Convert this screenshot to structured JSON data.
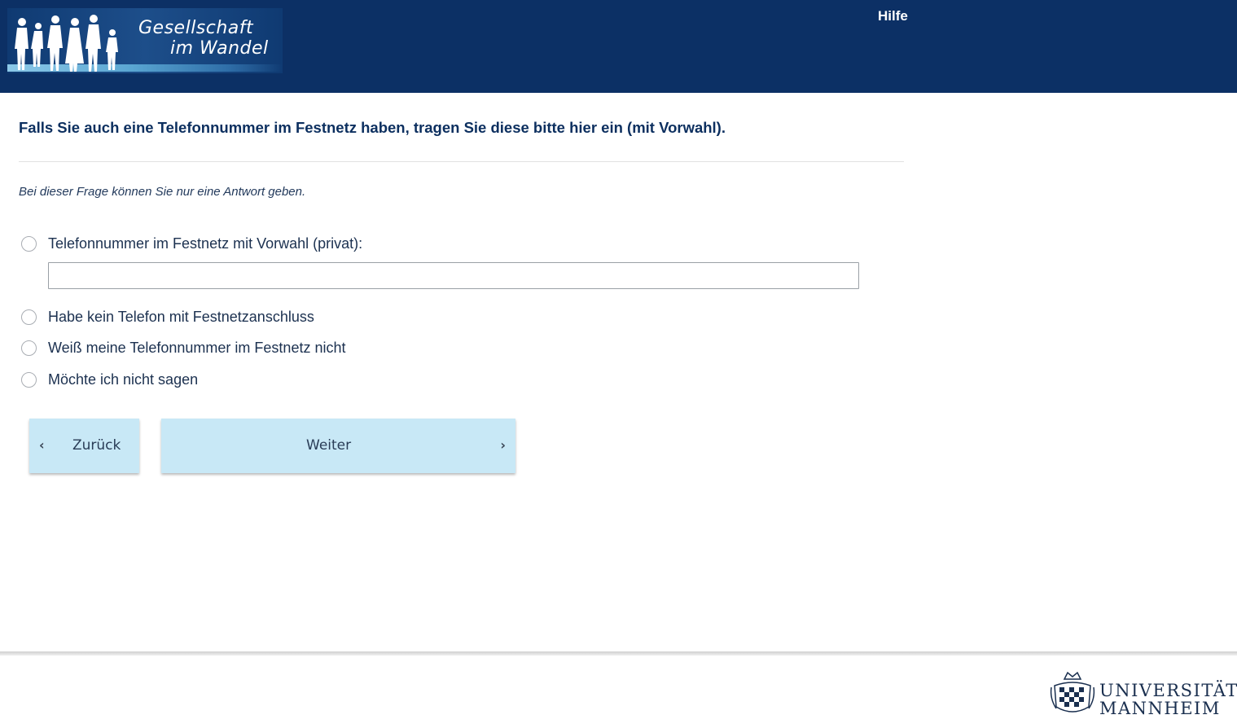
{
  "header": {
    "logo": {
      "line1": "Gesellschaft",
      "line2": "im Wandel"
    },
    "help_label": "Hilfe"
  },
  "colors": {
    "header_bg": "#0c3065",
    "text": "#0c2f5f",
    "button_bg": "#c8e8f6",
    "radio_border": "#a9adb3"
  },
  "survey": {
    "question": "Falls Sie auch eine Telefonnummer im Festnetz haben, tragen Sie diese bitte hier ein (mit Vorwahl).",
    "instruction": "Bei dieser Frage können Sie nur eine Antwort geben.",
    "options": [
      {
        "label": "Telefonnummer im Festnetz mit Vorwahl (privat):",
        "selected": false
      },
      {
        "label": "Habe kein Telefon mit Festnetzanschluss",
        "selected": false
      },
      {
        "label": "Weiß meine Telefonnummer im Festnetz nicht",
        "selected": false
      },
      {
        "label": "Möchte ich nicht sagen",
        "selected": false
      }
    ],
    "phone_input": {
      "value": "",
      "placeholder": ""
    }
  },
  "navigation": {
    "back": {
      "label": "Zurück",
      "icon": "chevron-left-icon"
    },
    "next": {
      "label": "Weiter",
      "icon": "chevron-right-icon"
    }
  },
  "footer": {
    "university": {
      "line1": "UNIVERSITÄT",
      "line2": "MANNHEIM"
    }
  }
}
